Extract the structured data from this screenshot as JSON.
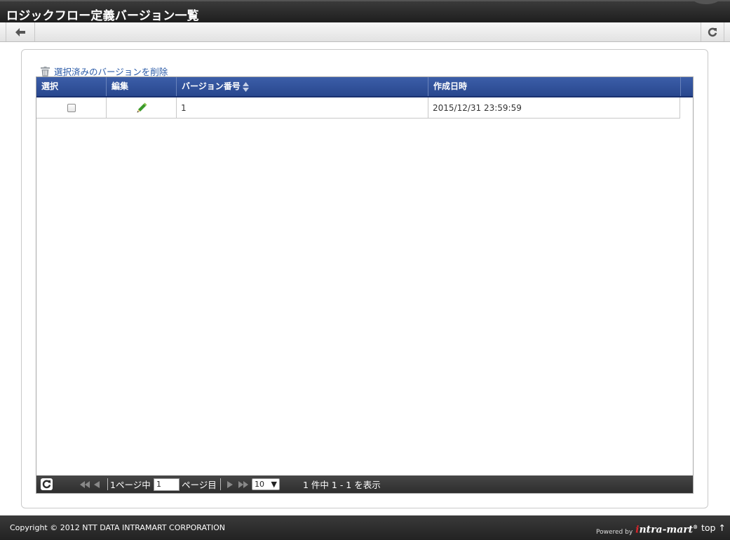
{
  "window": {
    "title": "ロジックフロー定義バージョン一覧"
  },
  "toolbar": {
    "back_icon": "arrow-left-icon",
    "reload_icon": "refresh-icon"
  },
  "actions": {
    "delete_selected": "選択済みのバージョンを削除",
    "delete_icon": "trash-icon"
  },
  "grid": {
    "columns": [
      {
        "label": "選択"
      },
      {
        "label": "編集"
      },
      {
        "label": "バージョン番号",
        "sortable": true
      },
      {
        "label": "作成日時"
      }
    ],
    "rows": [
      {
        "checked": false,
        "edit_icon": "pencil-icon",
        "version": "1",
        "created": "2015/12/31 23:59:59"
      }
    ]
  },
  "pager": {
    "total_pages_prefix": "1ページ中",
    "current_page": "1",
    "page_suffix": "ページ目",
    "page_size": "10",
    "summary": "1 件中 1 - 1 を表示"
  },
  "footer": {
    "copyright": "Copyright © 2012 NTT DATA INTRAMART CORPORATION",
    "powered_by": "Powered by",
    "brand_i": "i",
    "brand_rest": "ntra-mart",
    "brand_reg": "®",
    "top_link": "top ↑"
  },
  "colors": {
    "grid_header": "#2f4f98",
    "link": "#2a5aa7",
    "edit_icon": "#3a9a2a"
  }
}
